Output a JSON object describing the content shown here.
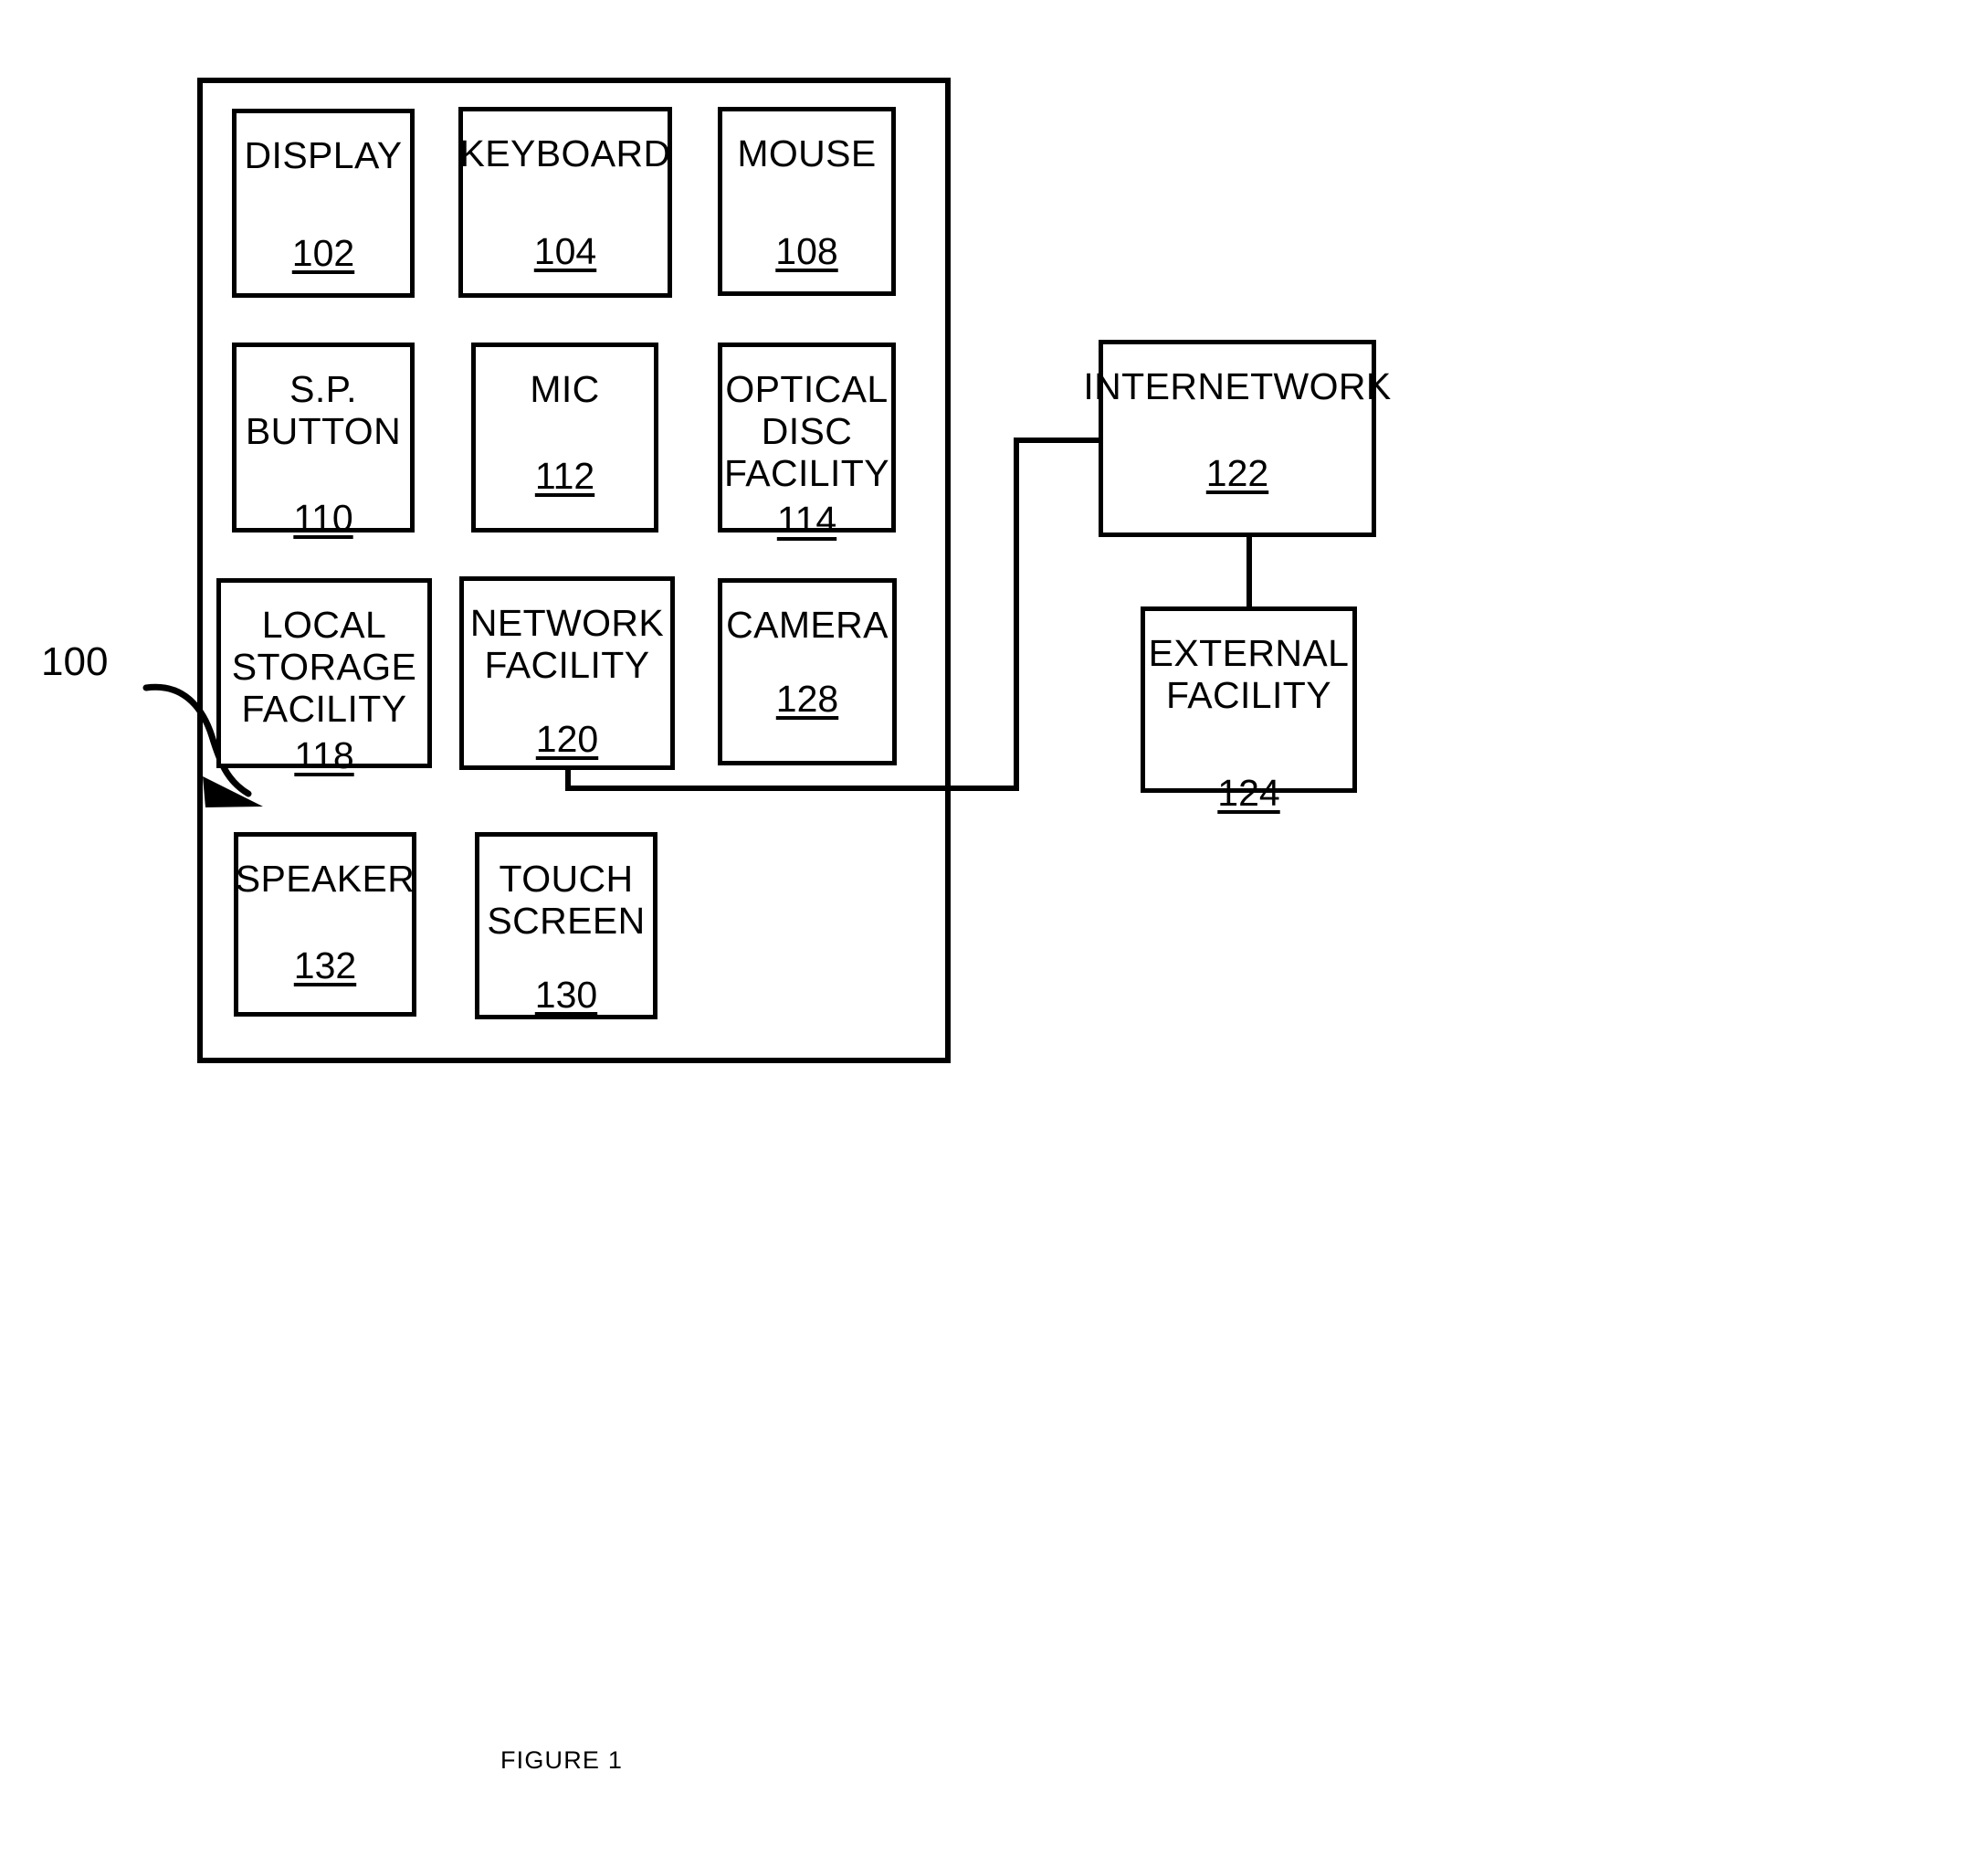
{
  "figure": {
    "caption": "FIGURE 1",
    "system_reference": "100"
  },
  "enclosure": {
    "name": "computing-device-enclosure"
  },
  "blocks": [
    {
      "id": "display",
      "label": "DISPLAY",
      "ref": "102"
    },
    {
      "id": "keyboard",
      "label": "KEYBOARD",
      "ref": "104"
    },
    {
      "id": "mouse",
      "label": "MOUSE",
      "ref": "108"
    },
    {
      "id": "sp-button",
      "label": "S.P.\nBUTTON",
      "ref": "110"
    },
    {
      "id": "mic",
      "label": "MIC",
      "ref": "112"
    },
    {
      "id": "optical-disc",
      "label": "OPTICAL\nDISC\nFACILITY",
      "ref": "114"
    },
    {
      "id": "local-storage",
      "label": "LOCAL\nSTORAGE\nFACILITY",
      "ref": "118"
    },
    {
      "id": "network",
      "label": "NETWORK\nFACILITY",
      "ref": "120"
    },
    {
      "id": "camera",
      "label": "CAMERA",
      "ref": "128"
    },
    {
      "id": "speaker",
      "label": "SPEAKER",
      "ref": "132"
    },
    {
      "id": "touch-screen",
      "label": "TOUCH\nSCREEN",
      "ref": "130"
    },
    {
      "id": "internetwork",
      "label": "INTERNETWORK",
      "ref": "122"
    },
    {
      "id": "external",
      "label": "EXTERNAL\nFACILITY",
      "ref": "124"
    }
  ],
  "connections": [
    {
      "from": "network",
      "to": "internetwork"
    },
    {
      "from": "internetwork",
      "to": "external"
    }
  ],
  "colors": {
    "stroke": "#000000",
    "background": "#ffffff"
  }
}
